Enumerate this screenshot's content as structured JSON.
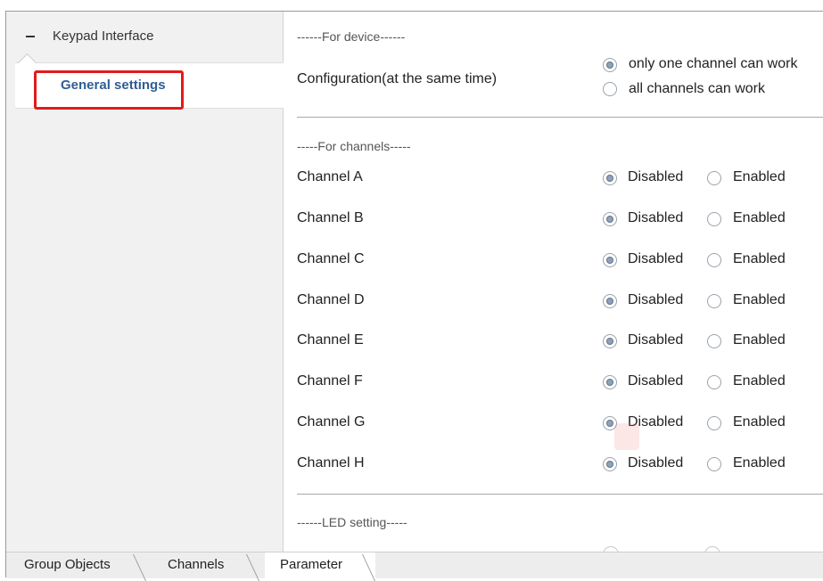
{
  "sidebar": {
    "root": {
      "label": "Keypad Interface"
    },
    "child": {
      "label": "General settings"
    }
  },
  "device": {
    "section_title": "------For device------",
    "configuration_label": "Configuration(at the same time)",
    "options": [
      {
        "label": "only one channel can work",
        "checked": true
      },
      {
        "label": "all channels can work",
        "checked": false
      }
    ]
  },
  "channels": {
    "section_title": "-----For channels-----",
    "disabled_label": "Disabled",
    "enabled_label": "Enabled",
    "rows": [
      {
        "label": "Channel A",
        "value": "Disabled"
      },
      {
        "label": "Channel B",
        "value": "Disabled"
      },
      {
        "label": "Channel C",
        "value": "Disabled"
      },
      {
        "label": "Channel D",
        "value": "Disabled"
      },
      {
        "label": "Channel E",
        "value": "Disabled"
      },
      {
        "label": "Channel F",
        "value": "Disabled"
      },
      {
        "label": "Channel G",
        "value": "Disabled"
      },
      {
        "label": "Channel H",
        "value": "Disabled"
      }
    ]
  },
  "led": {
    "section_title": "------LED setting-----"
  },
  "tabs": [
    {
      "label": "Group Objects",
      "active": false
    },
    {
      "label": "Channels",
      "active": false
    },
    {
      "label": "Parameter",
      "active": true
    }
  ]
}
